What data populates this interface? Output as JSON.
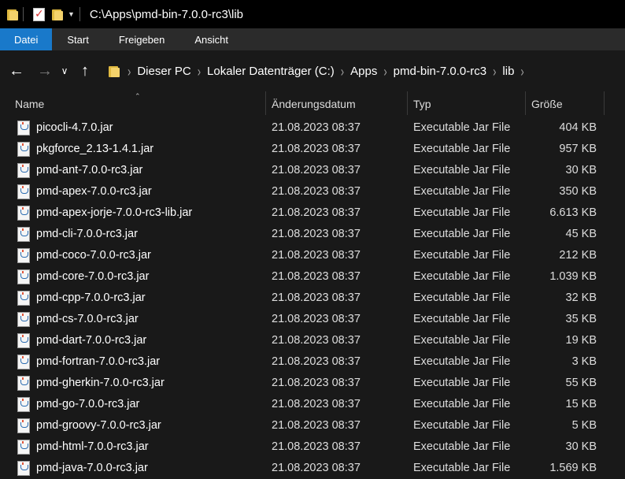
{
  "window": {
    "title": "C:\\Apps\\pmd-bin-7.0.0-rc3\\lib"
  },
  "ribbon": {
    "tabs": [
      "Datei",
      "Start",
      "Freigeben",
      "Ansicht"
    ]
  },
  "navigation": {
    "breadcrumbs": [
      "Dieser PC",
      "Lokaler Datenträger (C:)",
      "Apps",
      "pmd-bin-7.0.0-rc3",
      "lib"
    ]
  },
  "columns": {
    "name": "Name",
    "date": "Änderungsdatum",
    "type": "Typ",
    "size": "Größe"
  },
  "files": [
    {
      "name": "picocli-4.7.0.jar",
      "date": "21.08.2023 08:37",
      "type": "Executable Jar File",
      "size": "404 KB"
    },
    {
      "name": "pkgforce_2.13-1.4.1.jar",
      "date": "21.08.2023 08:37",
      "type": "Executable Jar File",
      "size": "957 KB"
    },
    {
      "name": "pmd-ant-7.0.0-rc3.jar",
      "date": "21.08.2023 08:37",
      "type": "Executable Jar File",
      "size": "30 KB"
    },
    {
      "name": "pmd-apex-7.0.0-rc3.jar",
      "date": "21.08.2023 08:37",
      "type": "Executable Jar File",
      "size": "350 KB"
    },
    {
      "name": "pmd-apex-jorje-7.0.0-rc3-lib.jar",
      "date": "21.08.2023 08:37",
      "type": "Executable Jar File",
      "size": "6.613 KB"
    },
    {
      "name": "pmd-cli-7.0.0-rc3.jar",
      "date": "21.08.2023 08:37",
      "type": "Executable Jar File",
      "size": "45 KB"
    },
    {
      "name": "pmd-coco-7.0.0-rc3.jar",
      "date": "21.08.2023 08:37",
      "type": "Executable Jar File",
      "size": "212 KB"
    },
    {
      "name": "pmd-core-7.0.0-rc3.jar",
      "date": "21.08.2023 08:37",
      "type": "Executable Jar File",
      "size": "1.039 KB"
    },
    {
      "name": "pmd-cpp-7.0.0-rc3.jar",
      "date": "21.08.2023 08:37",
      "type": "Executable Jar File",
      "size": "32 KB"
    },
    {
      "name": "pmd-cs-7.0.0-rc3.jar",
      "date": "21.08.2023 08:37",
      "type": "Executable Jar File",
      "size": "35 KB"
    },
    {
      "name": "pmd-dart-7.0.0-rc3.jar",
      "date": "21.08.2023 08:37",
      "type": "Executable Jar File",
      "size": "19 KB"
    },
    {
      "name": "pmd-fortran-7.0.0-rc3.jar",
      "date": "21.08.2023 08:37",
      "type": "Executable Jar File",
      "size": "3 KB"
    },
    {
      "name": "pmd-gherkin-7.0.0-rc3.jar",
      "date": "21.08.2023 08:37",
      "type": "Executable Jar File",
      "size": "55 KB"
    },
    {
      "name": "pmd-go-7.0.0-rc3.jar",
      "date": "21.08.2023 08:37",
      "type": "Executable Jar File",
      "size": "15 KB"
    },
    {
      "name": "pmd-groovy-7.0.0-rc3.jar",
      "date": "21.08.2023 08:37",
      "type": "Executable Jar File",
      "size": "5 KB"
    },
    {
      "name": "pmd-html-7.0.0-rc3.jar",
      "date": "21.08.2023 08:37",
      "type": "Executable Jar File",
      "size": "30 KB"
    },
    {
      "name": "pmd-java-7.0.0-rc3.jar",
      "date": "21.08.2023 08:37",
      "type": "Executable Jar File",
      "size": "1.569 KB"
    }
  ],
  "colors": {
    "file_tab": "#1979ca",
    "background": "#191919",
    "ribbon": "#2b2b2b",
    "folder": "#f4d26b"
  }
}
